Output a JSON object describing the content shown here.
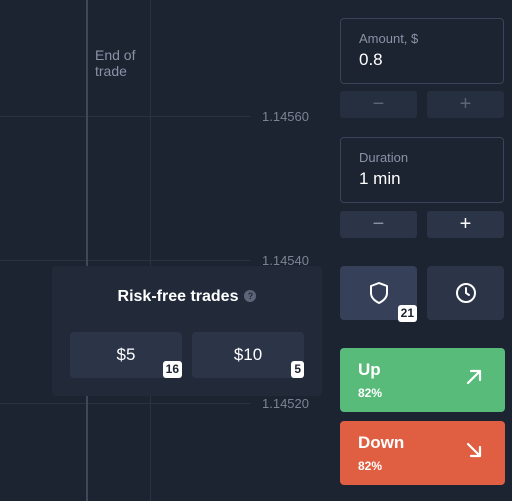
{
  "chart": {
    "end_of_trade_label": "End of trade",
    "price_levels": [
      "1.14560",
      "1.14540",
      "1.14520"
    ]
  },
  "risk_free": {
    "title": "Risk-free trades",
    "help_icon": "help-circle-icon",
    "options": [
      {
        "label": "$5",
        "count": "16"
      },
      {
        "label": "$10",
        "count": "5"
      }
    ]
  },
  "amount": {
    "label": "Amount, $",
    "value": "0.8",
    "decrease_label": "−",
    "increase_label": "+"
  },
  "duration": {
    "label": "Duration",
    "value": "1 min",
    "decrease_label": "−",
    "increase_label": "+"
  },
  "tools": {
    "shield_icon": "shield-icon",
    "shield_count": "21",
    "clock_icon": "clock-icon"
  },
  "trade": {
    "up": {
      "label": "Up",
      "payout": "82%",
      "icon": "arrow-up-right-icon",
      "color": "#58bb7a"
    },
    "down": {
      "label": "Down",
      "payout": "82%",
      "icon": "arrow-down-right-icon",
      "color": "#e05f43"
    }
  }
}
